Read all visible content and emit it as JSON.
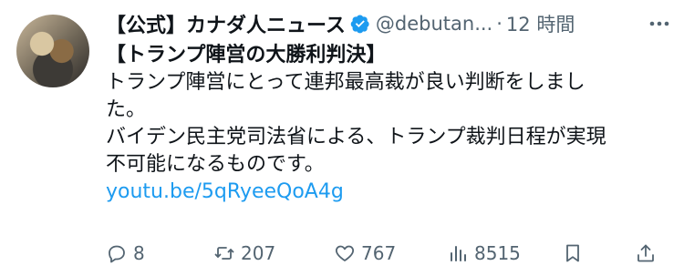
{
  "author": {
    "name": "【公式】カナダ人ニュース",
    "handle": "@debutan...",
    "separator": "·",
    "time": "12 時間"
  },
  "post": {
    "headline": "【トランプ陣営の大勝利判決】",
    "line1": "トランプ陣営にとって連邦最高裁が良い判断をしまし",
    "line2": "た。",
    "line3": "バイデン民主党司法省による、トランプ裁判日程が実現",
    "line4": "不可能になるものです。",
    "link": "youtu.be/5qRyeeQoA4g"
  },
  "actions": {
    "replies": "8",
    "reposts": "207",
    "likes": "767",
    "views": "8515"
  },
  "colors": {
    "text": "#0f1419",
    "secondary": "#536471",
    "link": "#1d9bf0",
    "verified": "#1d9bf0"
  }
}
